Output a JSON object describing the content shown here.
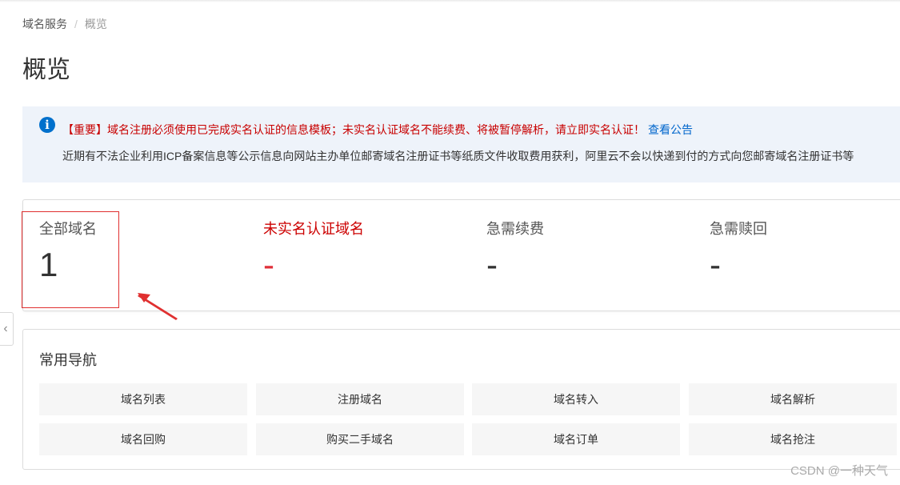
{
  "breadcrumb": {
    "parent": "域名服务",
    "separator": "/",
    "current": "概览"
  },
  "page": {
    "title": "概览"
  },
  "notice": {
    "important": "【重要】域名注册必须使用已完成实名认证的信息模板；未实名认证域名不能续费、将被暂停解析，请立即实名认证！",
    "link": "查看公告",
    "line2": "近期有不法企业利用ICP备案信息等公示信息向网站主办单位邮寄域名注册证书等纸质文件收取费用获利，阿里云不会以快递到付的方式向您邮寄域名注册证书等"
  },
  "stats": [
    {
      "label": "全部域名",
      "value": "1"
    },
    {
      "label": "未实名认证域名",
      "value": "-"
    },
    {
      "label": "急需续费",
      "value": "-"
    },
    {
      "label": "急需赎回",
      "value": "-"
    }
  ],
  "nav": {
    "title": "常用导航",
    "items": [
      "域名列表",
      "注册域名",
      "域名转入",
      "域名解析",
      "域名回购",
      "购买二手域名",
      "域名订单",
      "域名抢注"
    ]
  },
  "icons": {
    "info": "info-icon",
    "collapse": "chevron-left-icon",
    "annotation": "red-arrow-annotation"
  },
  "colors": {
    "warning": "#c80000",
    "link": "#0066cc",
    "info": "#0070cc",
    "annotation": "#e03030"
  },
  "watermark": "CSDN @一种天气"
}
